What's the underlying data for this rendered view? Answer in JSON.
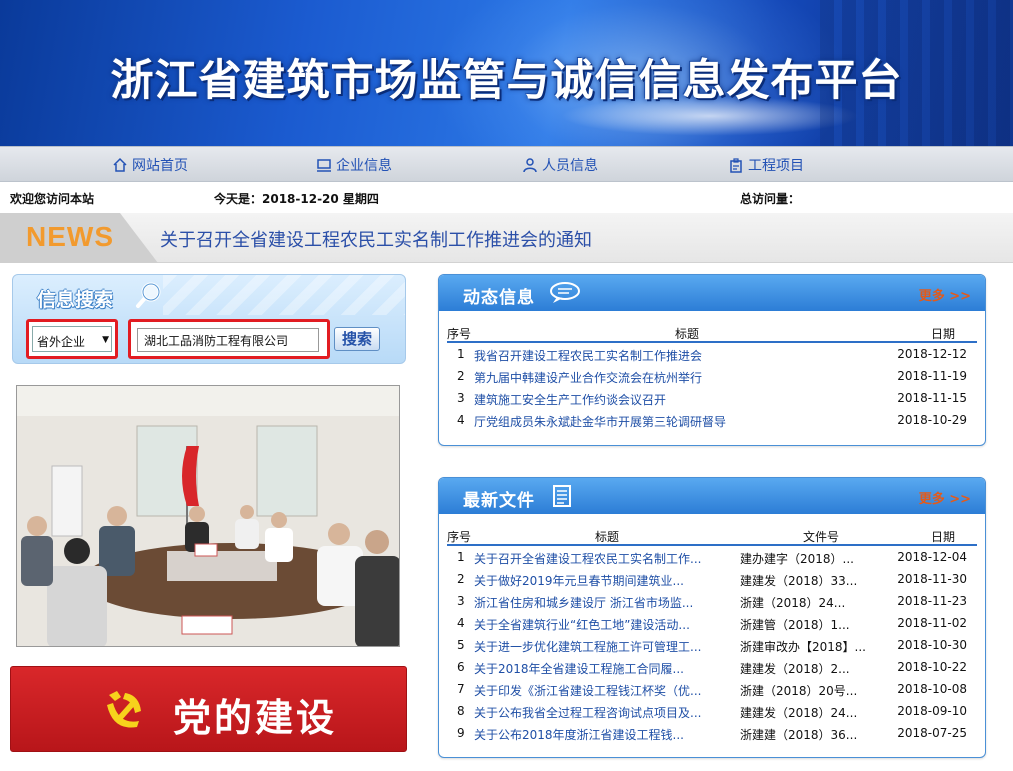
{
  "banner": {
    "title": "浙江省建筑市场监管与诚信信息发布平台"
  },
  "nav": {
    "items": [
      {
        "label": "网站首页",
        "icon": "home-icon"
      },
      {
        "label": "企业信息",
        "icon": "monitor-icon"
      },
      {
        "label": "人员信息",
        "icon": "person-icon"
      },
      {
        "label": "工程项目",
        "icon": "project-icon"
      }
    ]
  },
  "infobar": {
    "welcome": "欢迎您访问本站",
    "today": "今天是：2018-12-20 星期四",
    "visits": "总访问量："
  },
  "news": {
    "label": "NEWS",
    "headline": "关于召开全省建设工程农民工实名制工作推进会的通知"
  },
  "search": {
    "title": "信息搜索",
    "select_value": "省外企业",
    "input_value": "湖北工品消防工程有限公司",
    "button_label": "搜索"
  },
  "party": {
    "label": "党的建设"
  },
  "dynamic": {
    "title": "动态信息",
    "more": "更多 >>",
    "headers": {
      "idx": "序号",
      "title": "标题",
      "date": "日期"
    },
    "rows": [
      {
        "idx": "1",
        "title": "我省召开建设工程农民工实名制工作推进会",
        "date": "2018-12-12"
      },
      {
        "idx": "2",
        "title": "第九届中韩建设产业合作交流会在杭州举行",
        "date": "2018-11-19"
      },
      {
        "idx": "3",
        "title": "建筑施工安全生产工作约谈会议召开",
        "date": "2018-11-15"
      },
      {
        "idx": "4",
        "title": "厅党组成员朱永斌赴金华市开展第三轮调研督导",
        "date": "2018-10-29"
      }
    ]
  },
  "files": {
    "title": "最新文件",
    "more": "更多 >>",
    "headers": {
      "idx": "序号",
      "title": "标题",
      "doc": "文件号",
      "date": "日期"
    },
    "rows": [
      {
        "idx": "1",
        "title": "关于召开全省建设工程农民工实名制工作...",
        "doc": "建办建字（2018）...",
        "date": "2018-12-04"
      },
      {
        "idx": "2",
        "title": "关于做好2019年元旦春节期间建筑业...",
        "doc": "建建发（2018）33...",
        "date": "2018-11-30"
      },
      {
        "idx": "3",
        "title": "浙江省住房和城乡建设厅 浙江省市场监...",
        "doc": "浙建（2018）24...",
        "date": "2018-11-23"
      },
      {
        "idx": "4",
        "title": "关于全省建筑行业“红色工地”建设活动...",
        "doc": "浙建管（2018）1...",
        "date": "2018-11-02"
      },
      {
        "idx": "5",
        "title": "关于进一步优化建筑工程施工许可管理工...",
        "doc": "浙建审改办【2018】...",
        "date": "2018-10-30"
      },
      {
        "idx": "6",
        "title": "关于2018年全省建设工程施工合同履...",
        "doc": "建建发（2018）2...",
        "date": "2018-10-22"
      },
      {
        "idx": "7",
        "title": "关于印发《浙江省建设工程钱江杯奖（优...",
        "doc": "浙建（2018）20号...",
        "date": "2018-10-08"
      },
      {
        "idx": "8",
        "title": "关于公布我省全过程工程咨询试点项目及...",
        "doc": "建建发（2018）24...",
        "date": "2018-09-10"
      },
      {
        "idx": "9",
        "title": "关于公布2018年度浙江省建设工程钱...",
        "doc": "浙建建（2018）36...",
        "date": "2018-07-25"
      }
    ]
  },
  "colors": {
    "brand_blue": "#2c7dd6",
    "accent_red": "#e21c22",
    "news_orange": "#f29a2e"
  }
}
